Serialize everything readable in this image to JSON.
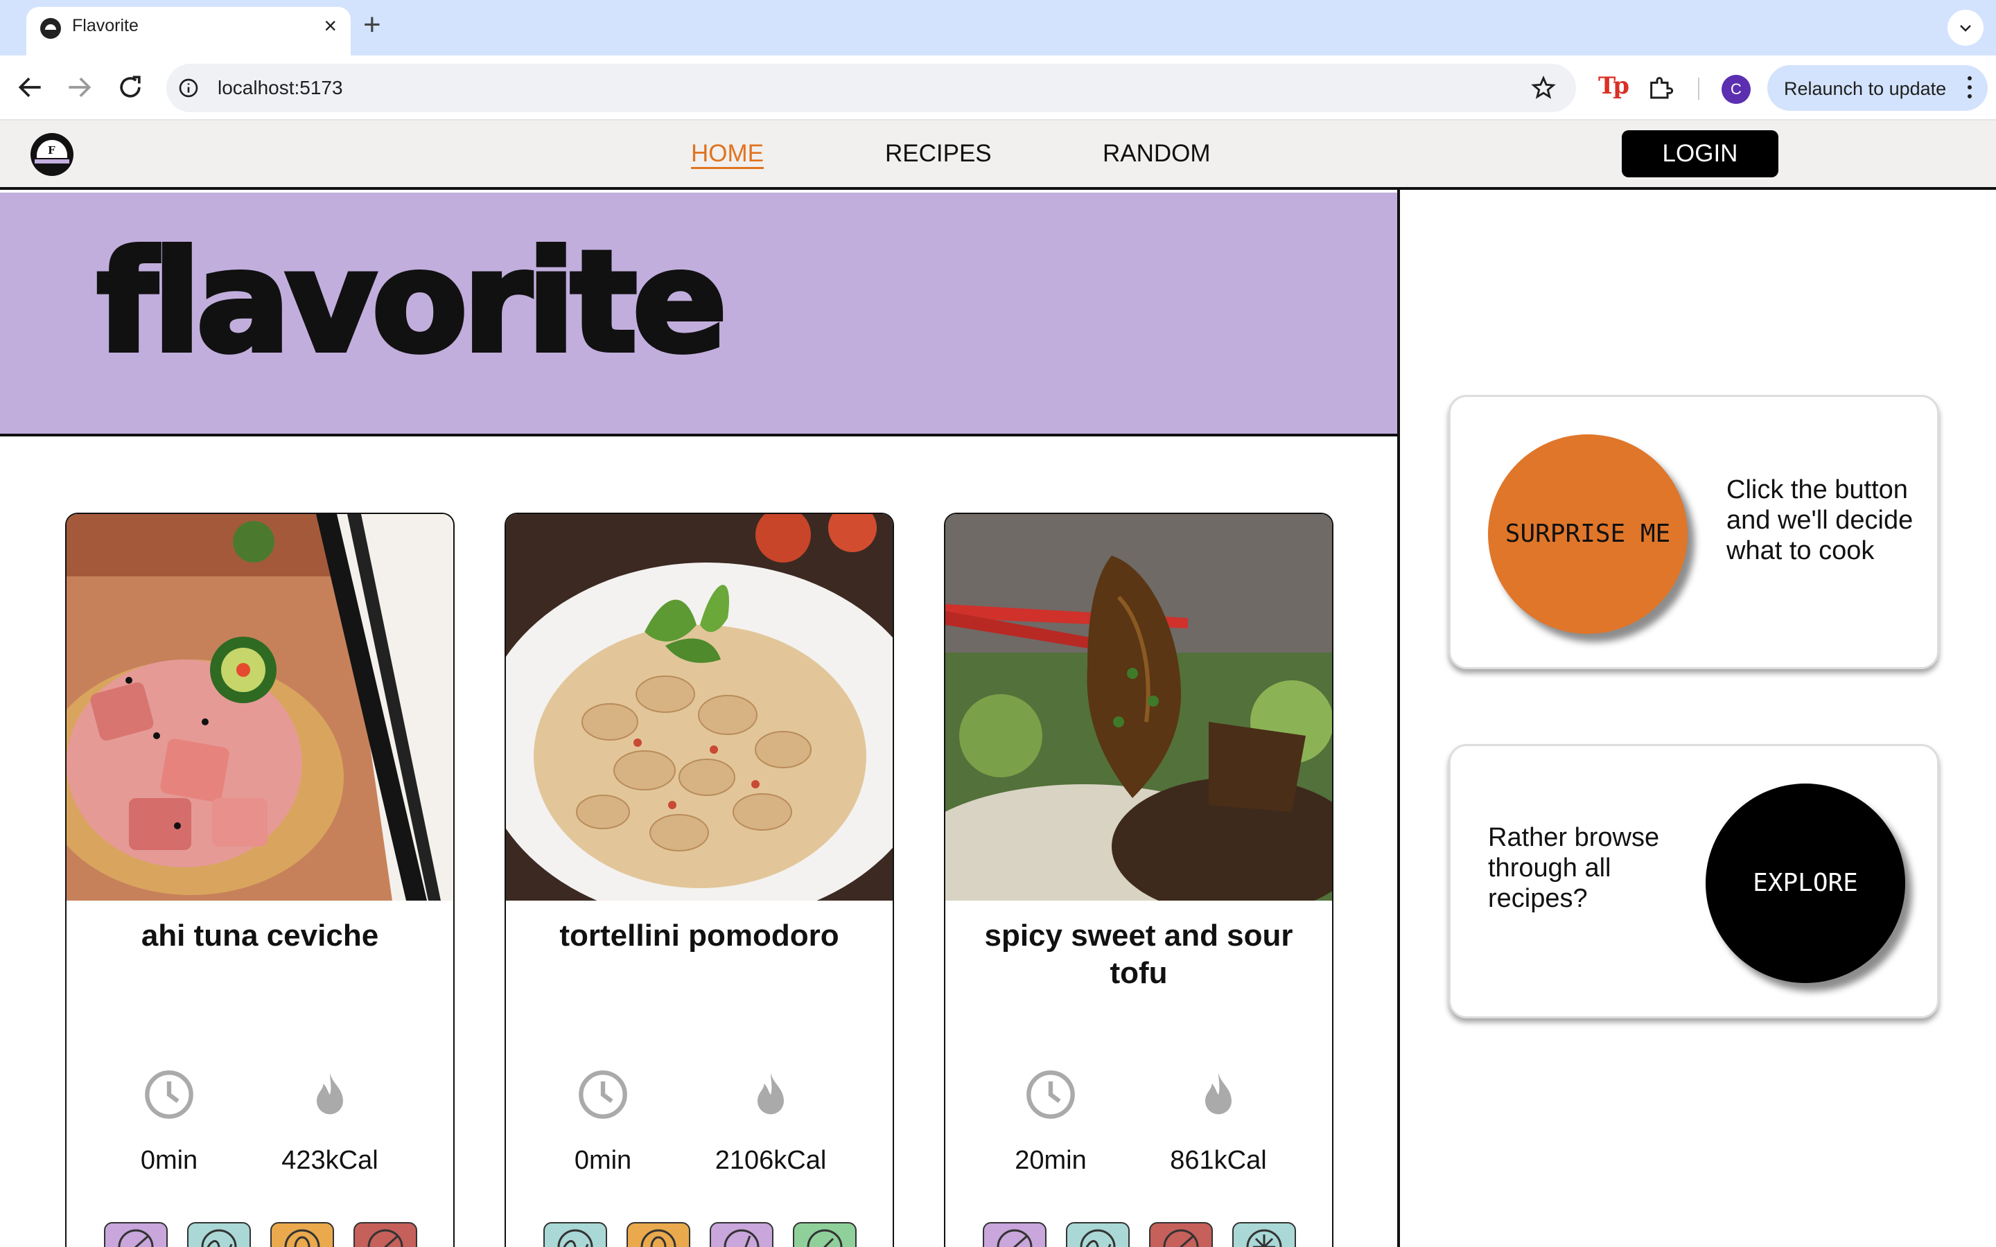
{
  "browser": {
    "tab_title": "Flavorite",
    "url": "localhost:5173",
    "profile_initial": "C",
    "extension_label": "Tp",
    "relaunch_label": "Relaunch to update"
  },
  "nav": {
    "logo_letter": "F",
    "links": [
      "HOME",
      "RECIPES",
      "RANDOM"
    ],
    "active": "HOME",
    "login_label": "LOGIN"
  },
  "hero": {
    "title": "flavorite"
  },
  "recipes": [
    {
      "name": "ahi tuna ceviche",
      "time": "0min",
      "calories": "423kCal",
      "diet_icons": [
        "sugar-free-icon",
        "seafood-icon",
        "nut-free-icon",
        "no-meat-icon"
      ]
    },
    {
      "name": "tortellini pomodoro",
      "time": "0min",
      "calories": "2106kCal",
      "diet_icons": [
        "seafood-icon",
        "nut-free-icon",
        "vegetarian-icon",
        "vegan-icon"
      ]
    },
    {
      "name": "spicy sweet and sour tofu",
      "time": "20min",
      "calories": "861kCal",
      "diet_icons": [
        "sugar-free-icon",
        "seafood-icon",
        "no-meat-icon",
        "dairy-free-icon"
      ]
    }
  ],
  "surprise": {
    "button_label": "SURPRISE ME",
    "text": "Click the button and we'll decide what to cook"
  },
  "explore": {
    "button_label": "EXPLORE",
    "text": "Rather browse through all recipes?"
  },
  "colors": {
    "accent_orange": "#e0762a",
    "hero_purple": "#c1aedd",
    "active_link": "#e07320"
  }
}
